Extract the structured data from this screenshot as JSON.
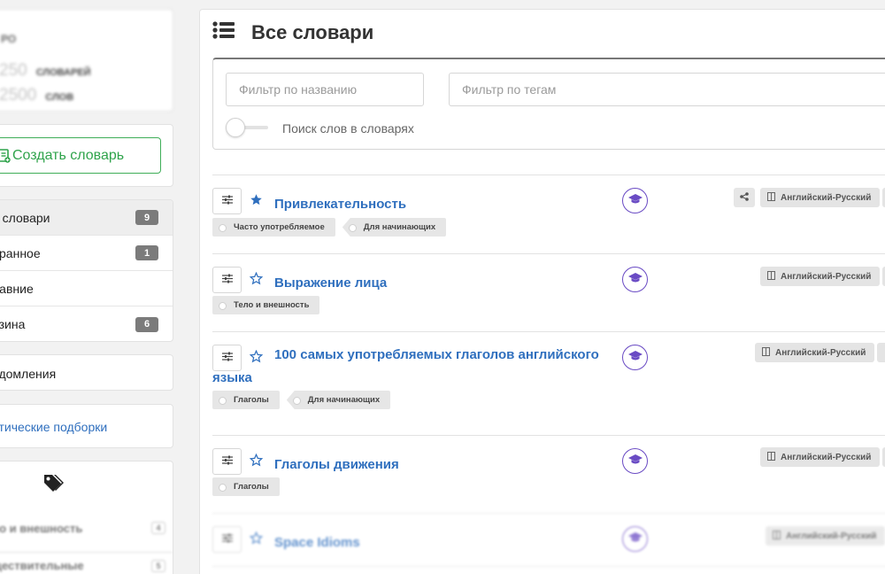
{
  "sidebar": {
    "stats": {
      "top_text": "РО",
      "rows": [
        {
          "num": "250",
          "label": "СЛОВАРЕЙ"
        },
        {
          "num": "2500",
          "label": "СЛОВ"
        }
      ]
    },
    "create_label": "Создать словарь",
    "nav": [
      {
        "label": "е словари",
        "count": "9",
        "active": true
      },
      {
        "label": "бранное",
        "count": "1",
        "active": false
      },
      {
        "label": "давние",
        "count": "",
        "active": false
      },
      {
        "label": "рзина",
        "count": "6",
        "active": false
      }
    ],
    "notifications_label": "едомления",
    "thematic_label": "атические подборки",
    "tag_list": [
      {
        "label": "ло и внешность",
        "count": "4"
      },
      {
        "label": "ществительные",
        "count": "5"
      }
    ]
  },
  "main": {
    "title": "Все словари",
    "filters": {
      "name_placeholder": "Фильтр по названию",
      "tags_placeholder": "Фильтр по тегам",
      "search_words_label": "Поиск слов в словарях"
    },
    "dictionaries": [
      {
        "title": "Привлекательность",
        "favorite": true,
        "language": "Английский-Русский",
        "shared": true,
        "tags": [
          "Часто употребляемое",
          "Для начинающих"
        ]
      },
      {
        "title": "Выражение лица",
        "favorite": false,
        "language": "Английский-Русский",
        "shared": false,
        "tags": [
          "Тело и внешность"
        ]
      },
      {
        "title": "100 самых употребляемых глаголов английского языка",
        "favorite": false,
        "language": "Английский-Русский",
        "shared": false,
        "tags": [
          "Глаголы",
          "Для начинающих"
        ]
      },
      {
        "title": "Глаголы движения",
        "favorite": false,
        "language": "Английский-Русский",
        "shared": false,
        "tags": [
          "Глаголы"
        ]
      },
      {
        "title": "Space Idioms",
        "favorite": false,
        "language": "Английский-Русский",
        "shared": false,
        "tags": []
      }
    ]
  },
  "colors": {
    "link_blue": "#2f6fbe",
    "create_green": "#2fa34b",
    "learn_purple": "#6a4bc4",
    "count_badge_gray": "#7b7b7b"
  },
  "icons": {
    "header": "list-icon",
    "create": "add-document-icon",
    "settings": "sliders-icon",
    "favorite": "star-icon",
    "learn": "graduation-cap-icon",
    "share": "share-icon",
    "language": "book-icon",
    "tags": "tags-icon"
  }
}
